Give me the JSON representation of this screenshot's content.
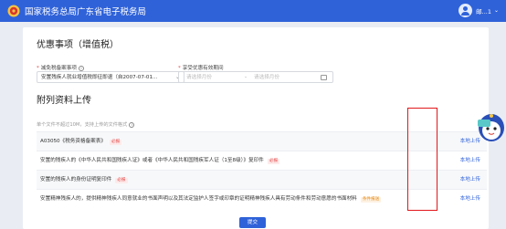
{
  "header": {
    "title": "国家税务总局广东省电子税务局",
    "user_name": "邮...1"
  },
  "page": {
    "title": "优惠事项（增值税）"
  },
  "form": {
    "reduction_item_label": "减免税备案事项",
    "reduction_item_value": "安置残疾人就业增值税即征即退（自2007-07-01...",
    "period_label": "享受优惠有效期间",
    "period_start_placeholder": "请选择月份",
    "period_separator": "-",
    "period_end_placeholder": "请选择月份"
  },
  "attachments": {
    "title": "附列资料上传",
    "hint": "单个文件不超过10M，支持上传的文件格式",
    "rows": [
      {
        "name": "A03050《税务资格备案表》",
        "tag": "必报",
        "tag_type": "red",
        "action": "本地上传"
      },
      {
        "name": "安置的残疾人的《中华人民共和国残疾人证》或者《中华人民共和国残疾军人证（1至8级）》复印件",
        "tag": "必报",
        "tag_type": "red",
        "action": "本地上传"
      },
      {
        "name": "安置的残疾人的身份证明复印件",
        "tag": "必报",
        "tag_type": "red",
        "action": "本地上传"
      },
      {
        "name": "安置精神残疾人的，提供精神残疾人同意就业的书面声明以及其法定监护人签字或印章的证明精神残疾人具有劳动条件和劳动意愿的书面材料",
        "tag": "条件报送",
        "tag_type": "orange",
        "action": "本地上传"
      }
    ]
  },
  "actions": {
    "submit_label": "提交"
  },
  "colors": {
    "brand": "#2f62d9",
    "required": "#e34848",
    "highlight_border": "#e1161b"
  }
}
